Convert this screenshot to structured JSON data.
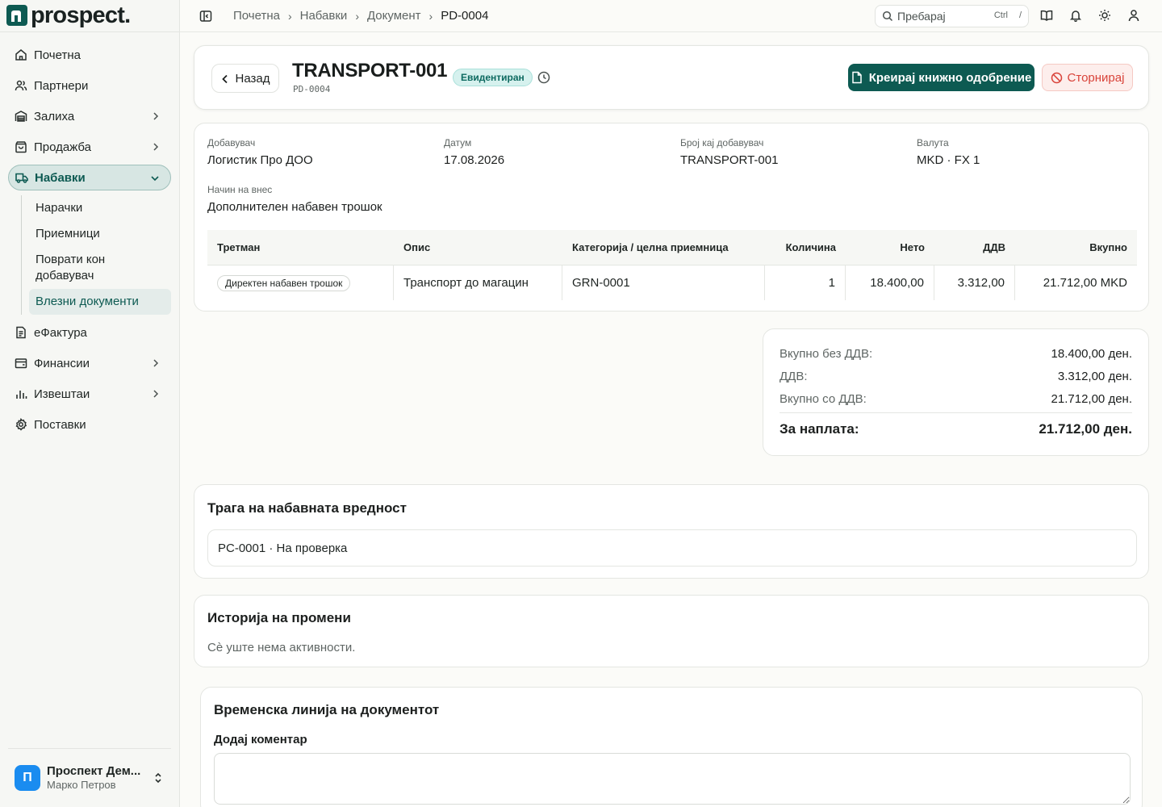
{
  "app": {
    "logo_text": "prospect."
  },
  "sidebar": {
    "items": [
      {
        "label": "Почетна",
        "icon": "home-icon"
      },
      {
        "label": "Партнери",
        "icon": "users-icon"
      },
      {
        "label": "Залиха",
        "icon": "warehouse-icon",
        "expandable": true
      },
      {
        "label": "Продажба",
        "icon": "shopping-bag-icon",
        "expandable": true
      },
      {
        "label": "Набавки",
        "icon": "truck-icon",
        "expanded": true,
        "active": true
      },
      {
        "label": "еФактура",
        "icon": "document-icon"
      },
      {
        "label": "Финансии",
        "icon": "wallet-icon",
        "expandable": true
      },
      {
        "label": "Извештаи",
        "icon": "bar-chart-icon",
        "expandable": true
      },
      {
        "label": "Поставки",
        "icon": "gear-icon"
      }
    ],
    "sub_items": [
      {
        "label": "Нарачки"
      },
      {
        "label": "Приемници"
      },
      {
        "label": "Поврати кон добавувач"
      },
      {
        "label": "Влезни документи",
        "active": true
      }
    ],
    "user": {
      "initial": "П",
      "name": "Проспект Дем...",
      "subtitle": "Марко Петров"
    }
  },
  "topbar": {
    "breadcrumb": [
      "Почетна",
      "Набавки",
      "Документ",
      "PD-0004"
    ],
    "search": {
      "placeholder": "Пребарај",
      "kbd_1": "Ctrl",
      "kbd_2": "/"
    }
  },
  "header": {
    "back_label": "Назад",
    "title": "TRANSPORT-001",
    "subtitle": "PD-0004",
    "status": "Евидентиран",
    "primary_action": "Креирај книжно одобрение",
    "danger_action": "Сторнирај"
  },
  "details": {
    "supplier_label": "Добавувач",
    "supplier_value": "Логистик Про ДОО",
    "date_label": "Датум",
    "date_value": "17.08.2026",
    "supplier_no_label": "Број кај добавувач",
    "supplier_no_value": "TRANSPORT-001",
    "currency_label": "Валута",
    "currency_value": "MKD · FX 1",
    "entry_label": "Начин на внес",
    "entry_value": "Дополнителен набавен трошок"
  },
  "table": {
    "headers": [
      "Третман",
      "Опис",
      "Категорија / целна приемница",
      "Количина",
      "Нето",
      "ДДВ",
      "Вкупно"
    ],
    "rows": [
      {
        "treatment": "Директен набавен трошок",
        "description": "Транспорт до магацин",
        "category": "GRN-0001",
        "quantity": "1",
        "net": "18.400,00",
        "vat": "3.312,00",
        "total": "21.712,00 MKD"
      }
    ]
  },
  "totals": {
    "net_label": "Вкупно без ДДВ:",
    "net_value": "18.400,00 ден.",
    "vat_label": "ДДВ:",
    "vat_value": "3.312,00 ден.",
    "gross_label": "Вкупно со ДДВ:",
    "gross_value": "21.712,00 ден.",
    "due_label": "За наплата:",
    "due_value": "21.712,00 ден."
  },
  "trace": {
    "title": "Трага на набавната вредност",
    "entry": "PC-0001 · На проверка"
  },
  "history": {
    "title": "Историја на промени",
    "empty": "Сè уште нема активности."
  },
  "timeline": {
    "title": "Временска линија на документот",
    "comment_label": "Додај коментар"
  },
  "colors": {
    "accent": "#0d5a52",
    "danger": "#d9433a",
    "status_bg": "#d6f1ee"
  }
}
